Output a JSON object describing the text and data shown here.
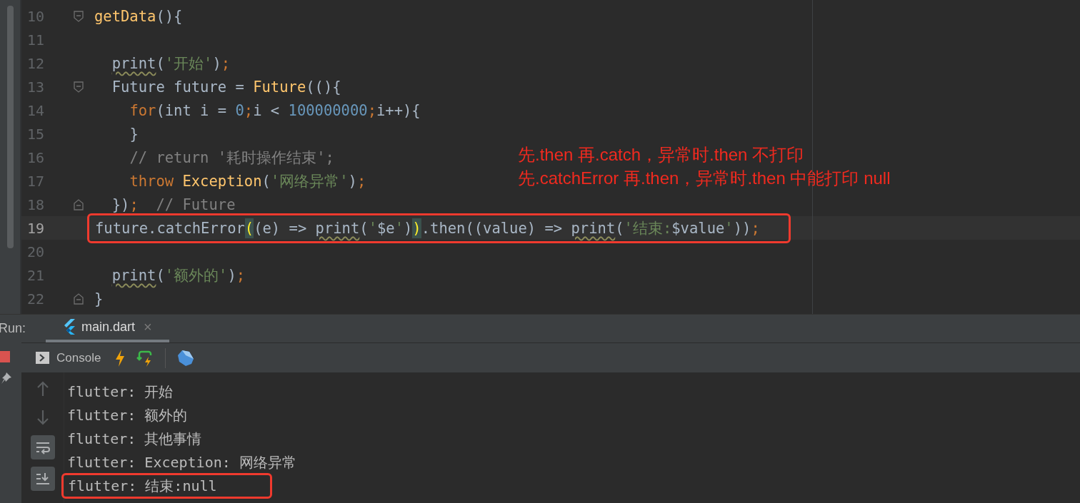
{
  "editor": {
    "lines": [
      {
        "number": "10",
        "fold_start": true,
        "fold_end": false,
        "current": false,
        "boxed": false,
        "tokens": [
          {
            "kind": "func",
            "text": "getData"
          },
          {
            "kind": "plain",
            "text": "(){"
          }
        ]
      },
      {
        "number": "11",
        "fold_start": false,
        "fold_end": false,
        "current": false,
        "boxed": false
      },
      {
        "number": "12",
        "fold_start": false,
        "fold_end": false,
        "current": false,
        "boxed": false,
        "tokens": [
          {
            "kind": "warn",
            "text": "  print"
          },
          {
            "kind": "plain",
            "text": "("
          },
          {
            "kind": "string",
            "text": "'开始'"
          },
          {
            "kind": "plain",
            "text": ")"
          },
          {
            "kind": "keyword",
            "text": ";"
          }
        ]
      },
      {
        "number": "13",
        "fold_start": true,
        "fold_end": false,
        "current": false,
        "boxed": false,
        "tokens": [
          {
            "kind": "plain",
            "text": "  Future future = "
          },
          {
            "kind": "func",
            "text": "Future"
          },
          {
            "kind": "plain",
            "text": "((){"
          }
        ]
      },
      {
        "number": "14",
        "fold_start": false,
        "fold_end": false,
        "current": false,
        "boxed": false,
        "tokens": [
          {
            "kind": "keyword",
            "text": "    for"
          },
          {
            "kind": "plain",
            "text": "(int i = "
          },
          {
            "kind": "number",
            "text": "0"
          },
          {
            "kind": "keyword",
            "text": ";"
          },
          {
            "kind": "plain",
            "text": "i < "
          },
          {
            "kind": "number",
            "text": "100000000"
          },
          {
            "kind": "keyword",
            "text": ";"
          },
          {
            "kind": "plain",
            "text": "i++){"
          }
        ]
      },
      {
        "number": "15",
        "fold_start": false,
        "fold_end": false,
        "current": false,
        "boxed": false,
        "tokens": [
          {
            "kind": "plain",
            "text": "    }"
          }
        ]
      },
      {
        "number": "16",
        "fold_start": false,
        "fold_end": false,
        "current": false,
        "boxed": false,
        "tokens": [
          {
            "kind": "comment",
            "text": "    // return '耗时操作结束';"
          }
        ]
      },
      {
        "number": "17",
        "fold_start": false,
        "fold_end": false,
        "current": false,
        "boxed": false,
        "tokens": [
          {
            "kind": "keyword",
            "text": "    throw "
          },
          {
            "kind": "func",
            "text": "Exception"
          },
          {
            "kind": "plain",
            "text": "("
          },
          {
            "kind": "string",
            "text": "'网络异常'"
          },
          {
            "kind": "plain",
            "text": ")"
          },
          {
            "kind": "keyword",
            "text": ";"
          }
        ]
      },
      {
        "number": "18",
        "fold_start": false,
        "fold_end": true,
        "current": false,
        "boxed": false,
        "tokens": [
          {
            "kind": "plain",
            "text": "  })"
          },
          {
            "kind": "keyword",
            "text": ";"
          },
          {
            "kind": "comment",
            "text": "  // Future"
          }
        ]
      },
      {
        "number": "19",
        "fold_start": false,
        "fold_end": false,
        "current": true,
        "boxed": true,
        "tokens": [
          {
            "kind": "plain",
            "text": "future.catchError"
          },
          {
            "kind": "match",
            "text": "("
          },
          {
            "kind": "plain",
            "text": "(e) => "
          },
          {
            "kind": "warn",
            "text": "print"
          },
          {
            "kind": "plain",
            "text": "("
          },
          {
            "kind": "string",
            "text": "'"
          },
          {
            "kind": "plain",
            "text": "$e"
          },
          {
            "kind": "string",
            "text": "'"
          },
          {
            "kind": "plain",
            "text": ")"
          },
          {
            "kind": "match",
            "text": ")"
          },
          {
            "kind": "plain",
            "text": ".then((value) => "
          },
          {
            "kind": "warn",
            "text": "print"
          },
          {
            "kind": "plain",
            "text": "("
          },
          {
            "kind": "string",
            "text": "'结束:"
          },
          {
            "kind": "plain",
            "text": "$value"
          },
          {
            "kind": "string",
            "text": "'"
          },
          {
            "kind": "plain",
            "text": "))"
          },
          {
            "kind": "keyword",
            "text": ";"
          }
        ]
      },
      {
        "number": "20",
        "fold_start": false,
        "fold_end": false,
        "current": false,
        "boxed": false
      },
      {
        "number": "21",
        "fold_start": false,
        "fold_end": false,
        "current": false,
        "boxed": false,
        "tokens": [
          {
            "kind": "warn",
            "text": "  print"
          },
          {
            "kind": "plain",
            "text": "("
          },
          {
            "kind": "string",
            "text": "'额外的'"
          },
          {
            "kind": "plain",
            "text": ")"
          },
          {
            "kind": "keyword",
            "text": ";"
          }
        ]
      },
      {
        "number": "22",
        "fold_start": false,
        "fold_end": true,
        "current": false,
        "boxed": false,
        "tokens": [
          {
            "kind": "plain",
            "text": "}"
          }
        ]
      }
    ],
    "annotation": [
      "先.then 再.catch，异常时.then 不打印",
      "先.catchError 再.then，异常时.then 中能打印 null"
    ]
  },
  "run_panel": {
    "label": "Run:",
    "tabs": [
      {
        "label": "main.dart",
        "selected": true,
        "close": "×"
      }
    ],
    "toolbar": {
      "console_label": "Console"
    },
    "output": [
      {
        "text": "flutter: 开始",
        "boxed": false
      },
      {
        "text": "flutter: 额外的",
        "boxed": false
      },
      {
        "text": "flutter: 其他事情",
        "boxed": false
      },
      {
        "text": "flutter: Exception: 网络异常",
        "boxed": false
      },
      {
        "text": "flutter: 结束:null",
        "boxed": true
      }
    ]
  }
}
